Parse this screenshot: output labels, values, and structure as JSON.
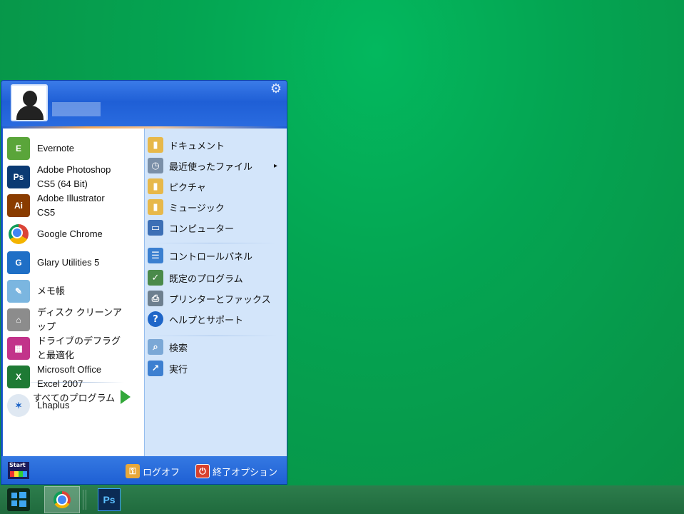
{
  "start_menu": {
    "user_name": "",
    "programs": [
      {
        "name": "evernote",
        "label": "Evernote",
        "icon": "evernote-icon",
        "color": "#5aa53a",
        "glyph": "E"
      },
      {
        "name": "photoshop",
        "label": "Adobe Photoshop CS5 (64 Bit)",
        "icon": "photoshop-icon",
        "color": "#0b3a73",
        "glyph": "Ps"
      },
      {
        "name": "illustrator",
        "label": "Adobe Illustrator CS5",
        "icon": "illustrator-icon",
        "color": "#8a3c00",
        "glyph": "Ai"
      },
      {
        "name": "google-chrome",
        "label": "Google Chrome",
        "icon": "chrome-icon",
        "color": "#ffffff",
        "glyph": ""
      },
      {
        "name": "glary-utilities",
        "label": "Glary Utilities 5",
        "icon": "glary-utilities-icon",
        "color": "#1f6fc6",
        "glyph": "G"
      },
      {
        "name": "notepad",
        "label": "メモ帳",
        "icon": "notepad-icon",
        "color": "#7bb6e0",
        "glyph": "✎"
      },
      {
        "name": "disk-cleanup",
        "label": "ディスク クリーンアップ",
        "icon": "disk-cleanup-icon",
        "color": "#8c8c8c",
        "glyph": "⌂"
      },
      {
        "name": "defrag",
        "label": "ドライブのデフラグと最適化",
        "icon": "defrag-icon",
        "color": "#c2338a",
        "glyph": "▦"
      },
      {
        "name": "excel",
        "label": "Microsoft Office Excel 2007",
        "icon": "excel-icon",
        "color": "#1e7a34",
        "glyph": "X"
      },
      {
        "name": "lhaplus",
        "label": "Lhaplus",
        "icon": "lhaplus-icon",
        "color": "#dfe8f2",
        "glyph": "✶"
      }
    ],
    "all_programs_label": "すべてのプログラム",
    "places": [
      {
        "name": "documents",
        "label": "ドキュメント",
        "icon": "folder-documents-icon",
        "color": "#e7b84a",
        "glyph": "▮"
      },
      {
        "name": "recent-files",
        "label": "最近使ったファイル",
        "icon": "recent-files-icon",
        "color": "#7a8fa8",
        "glyph": "◷",
        "submenu": "▸"
      },
      {
        "name": "pictures",
        "label": "ピクチャ",
        "icon": "folder-pictures-icon",
        "color": "#e7b84a",
        "glyph": "▮"
      },
      {
        "name": "music",
        "label": "ミュージック",
        "icon": "folder-music-icon",
        "color": "#e7b84a",
        "glyph": "▮"
      },
      {
        "name": "computer",
        "label": "コンピューター",
        "icon": "computer-icon",
        "color": "#3d6fb5",
        "glyph": "▭"
      },
      {
        "name": "control-panel",
        "label": "コントロールパネル",
        "icon": "control-panel-icon",
        "color": "#3a7fd0",
        "glyph": "☰"
      },
      {
        "name": "default-programs",
        "label": "既定のプログラム",
        "icon": "default-programs-icon",
        "color": "#4a8a4a",
        "glyph": "✓"
      },
      {
        "name": "printers",
        "label": "プリンターとファックス",
        "icon": "printer-icon",
        "color": "#6d7f8f",
        "glyph": "⎙"
      },
      {
        "name": "help",
        "label": "ヘルプとサポート",
        "icon": "help-icon",
        "color": "#1f66c8",
        "glyph": "?"
      },
      {
        "name": "search",
        "label": "検索",
        "icon": "search-icon",
        "color": "#7ba8d6",
        "glyph": "⌕"
      },
      {
        "name": "run",
        "label": "実行",
        "icon": "run-icon",
        "color": "#3d7fd0",
        "glyph": "↗"
      }
    ],
    "footer": {
      "start_logo_text": "Start",
      "logoff_label": "ログオフ",
      "shutdown_label": "終了オプション"
    }
  },
  "taskbar": {
    "items": [
      "windows-start-icon",
      "chrome-icon",
      "photoshop-icon"
    ],
    "photoshop_glyph": "Ps"
  }
}
